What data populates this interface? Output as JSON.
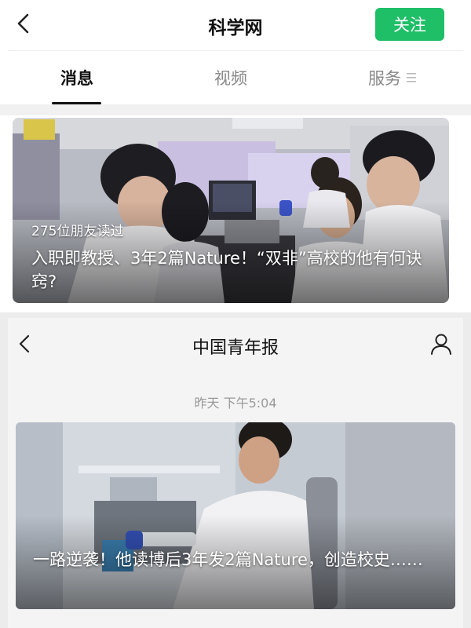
{
  "account": {
    "title": "科学网",
    "follow_label": "关注"
  },
  "tabs": [
    {
      "label": "消息",
      "active": true
    },
    {
      "label": "视频",
      "active": false
    },
    {
      "label": "服务",
      "active": false
    }
  ],
  "featured": {
    "read_count": "275位朋友读过",
    "title": "入职即教授、3年2篇Nature！“双非”高校的他有何诀窍?"
  },
  "article_page": {
    "title": "中国青年报",
    "timestamp": "昨天 下午5:04",
    "card_title": "一路逆袭！他读博后3年发2篇Nature，创造校史……"
  },
  "icons": {
    "back": "chevron-left-icon",
    "menu": "menu-lines-icon",
    "profile": "person-icon"
  },
  "colors": {
    "accent": "#1fbf68",
    "text": "#111111",
    "muted": "#999999"
  }
}
